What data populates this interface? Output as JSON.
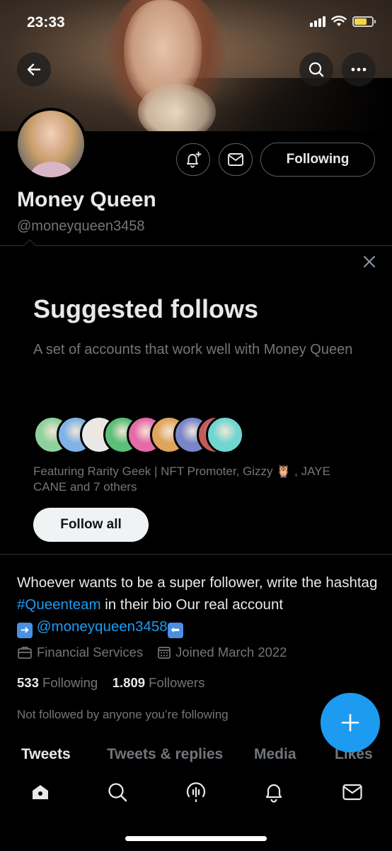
{
  "status_bar": {
    "time": "23:33",
    "battery_color": "#f5d547"
  },
  "header": {
    "back_icon": "arrow-left-icon",
    "search_icon": "search-icon",
    "more_icon": "ellipsis-icon"
  },
  "profile": {
    "name": "Money Queen",
    "handle": "@moneyqueen3458",
    "notify_icon": "bell-plus-icon",
    "message_icon": "mail-icon",
    "following_label": "Following"
  },
  "suggested": {
    "title": "Suggested follows",
    "description": "A set of accounts that work well with Money Queen",
    "featuring": "Featuring Rarity Geek | NFT Promoter, Gizzy 🦉 , JAYE CANE and 7 others",
    "follow_all_label": "Follow all",
    "dismiss_icon": "close-icon",
    "avatar_colors": [
      "#8fd19e",
      "#7fb3e6",
      "#e8e8e8",
      "#5bbf7a",
      "#e36ba7",
      "#e0a45c",
      "#7a86c9",
      "#c45a5a",
      "#6fd6d2"
    ]
  },
  "bio": {
    "text_before": "Whoever wants to be a super follower, write the hashtag ",
    "hashtag": "#Queenteam",
    "text_middle": " in their bio Our real account ",
    "arrow_right": "➡️",
    "mention": "@moneyqueen3458",
    "arrow_left": "⬅️"
  },
  "meta": {
    "category_icon": "briefcase-icon",
    "category": "Financial Services",
    "calendar_icon": "calendar-icon",
    "joined": "Joined March 2022"
  },
  "stats": {
    "following_count": "533",
    "following_label": "Following",
    "followers_count": "1.809",
    "followers_label": "Followers"
  },
  "not_followed": "Not followed by anyone you’re following",
  "compose_icon": "plus-icon",
  "tabs": [
    {
      "label": "Tweets",
      "active": true
    },
    {
      "label": "Tweets & replies",
      "active": false
    },
    {
      "label": "Media",
      "active": false
    },
    {
      "label": "Likes",
      "active": false
    }
  ],
  "bottom_nav": [
    "home-icon",
    "search-icon",
    "spaces-icon",
    "notifications-icon",
    "messages-icon"
  ],
  "accent_color": "#1d9bf0"
}
